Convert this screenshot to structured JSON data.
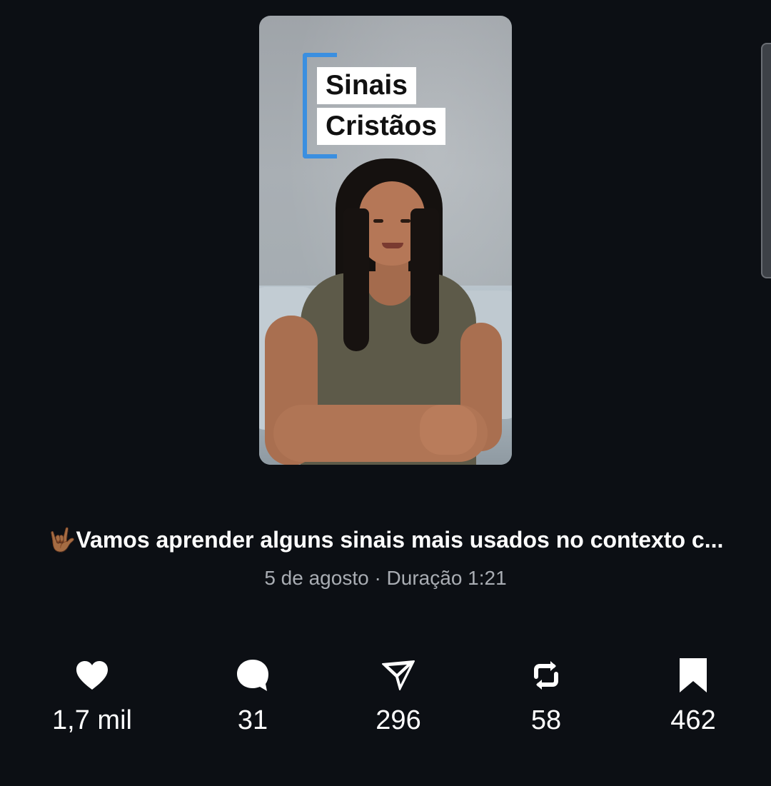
{
  "video": {
    "overlay_title_line1": "Sinais",
    "overlay_title_line2": "Cristãos",
    "accent_color": "#3b8fe0"
  },
  "post": {
    "caption": "🤟🏾Vamos aprender alguns sinais mais usados no contexto c...",
    "meta": "5 de agosto · Duração 1:21"
  },
  "actions": {
    "like": {
      "icon": "heart-icon",
      "count": "1,7 mil"
    },
    "comment": {
      "icon": "comment-bubble-icon",
      "count": "31"
    },
    "share": {
      "icon": "send-arrow-icon",
      "count": "296"
    },
    "repost": {
      "icon": "repost-icon",
      "count": "58"
    },
    "save": {
      "icon": "bookmark-icon",
      "count": "462"
    }
  }
}
